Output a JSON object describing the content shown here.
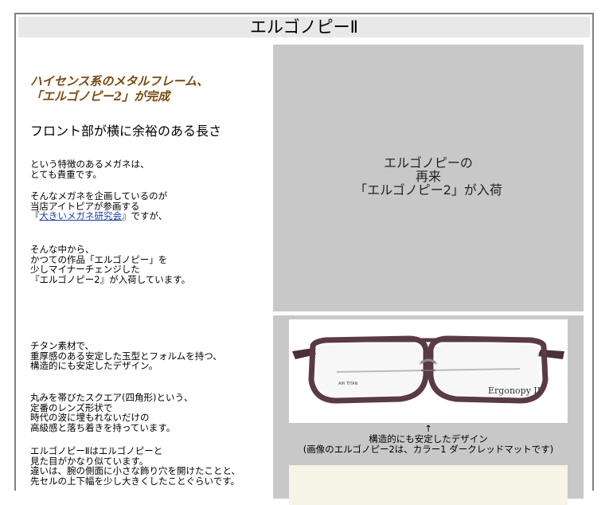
{
  "page": {
    "title": "エルゴノピーⅡ"
  },
  "left": {
    "headline_line1": "ハイセンス系のメタルフレーム、",
    "headline_line2": "「エルゴノピー2」が完成",
    "subhead": "フロント部が横に余裕のある長さ",
    "p1": [
      "という特徴のあるメガネは、",
      "とても貴重です。"
    ],
    "p2_line1": "そんなメガネを企画しているのが",
    "p2_line2": "当店アイトピアが参画する",
    "p2_prefix": "『",
    "p2_link": "大きいメガネ研究会",
    "p2_suffix": "』ですが、",
    "p3": [
      "そんな中から、",
      "かつての作品「エルゴノピー」を",
      "少しマイナーチェンジした",
      "『エルゴノピー2』が入荷しています。"
    ],
    "p4": [
      "チタン素材で、",
      "重厚感のある安定した玉型とフォルムを持つ、",
      "構造的にも安定したデザイン。"
    ],
    "p5": [
      "丸みを帯びたスクエア(四角形)という、",
      "定番のレンズ形状で",
      "時代の波に埋もれないだけの",
      "高級感と落ち着きを持っています。"
    ],
    "p6": [
      "エルゴノピーⅡはエルゴノピーと",
      "見た目がかなり似ています。",
      "違いは、腕の側面に小さな飾り穴を開けたことと、",
      "先セルの上下幅を少し大きくしたことぐらいです。"
    ]
  },
  "right": {
    "top_text": [
      "エルゴノピーの",
      "再来",
      "「エルゴノピー2」が入荷"
    ],
    "photo_brand": "Ergonopy II",
    "photo_temple_text": "AIR TITAN",
    "caption_arrow": "↑",
    "caption_line1": "構造的にも安定したデザイン",
    "caption_line2": "(画像のエルゴノピー2は、カラー1 ダークレッドマットです)"
  },
  "colors": {
    "headline": "#7a4a10",
    "frame_metal": "#5a3a44",
    "panel_gray": "#c8c8c8",
    "link": "#1a3fa8"
  }
}
